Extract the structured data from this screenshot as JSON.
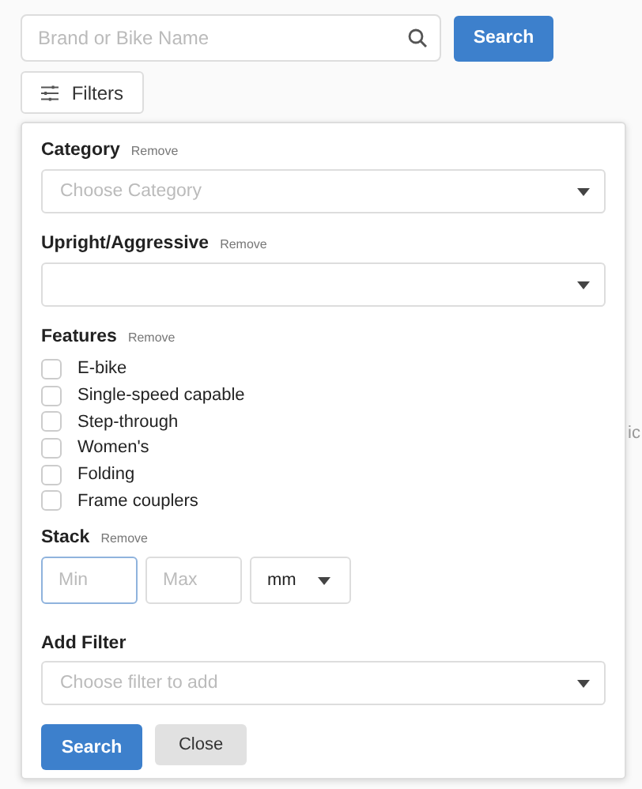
{
  "search": {
    "placeholder": "Brand or Bike Name",
    "button": "Search"
  },
  "filters_button": "Filters",
  "background_text": "ic",
  "panel": {
    "category": {
      "label": "Category",
      "remove": "Remove",
      "placeholder": "Choose Category"
    },
    "upright": {
      "label": "Upright/Aggressive",
      "remove": "Remove"
    },
    "features": {
      "label": "Features",
      "remove": "Remove",
      "options": [
        {
          "label": "E-bike",
          "checked": false
        },
        {
          "label": "Single-speed capable",
          "checked": false
        },
        {
          "label": "Step-through",
          "checked": false
        },
        {
          "label": "Women's",
          "checked": false
        },
        {
          "label": "Folding",
          "checked": false
        },
        {
          "label": "Frame couplers",
          "checked": false
        }
      ]
    },
    "stack": {
      "label": "Stack",
      "remove": "Remove",
      "min": {
        "placeholder": "Min",
        "focused": true
      },
      "max": {
        "placeholder": "Max",
        "focused": false
      },
      "unit": "mm"
    },
    "add_filter": {
      "label": "Add Filter",
      "placeholder": "Choose filter to add"
    },
    "buttons": {
      "search": "Search",
      "close": "Close"
    }
  }
}
